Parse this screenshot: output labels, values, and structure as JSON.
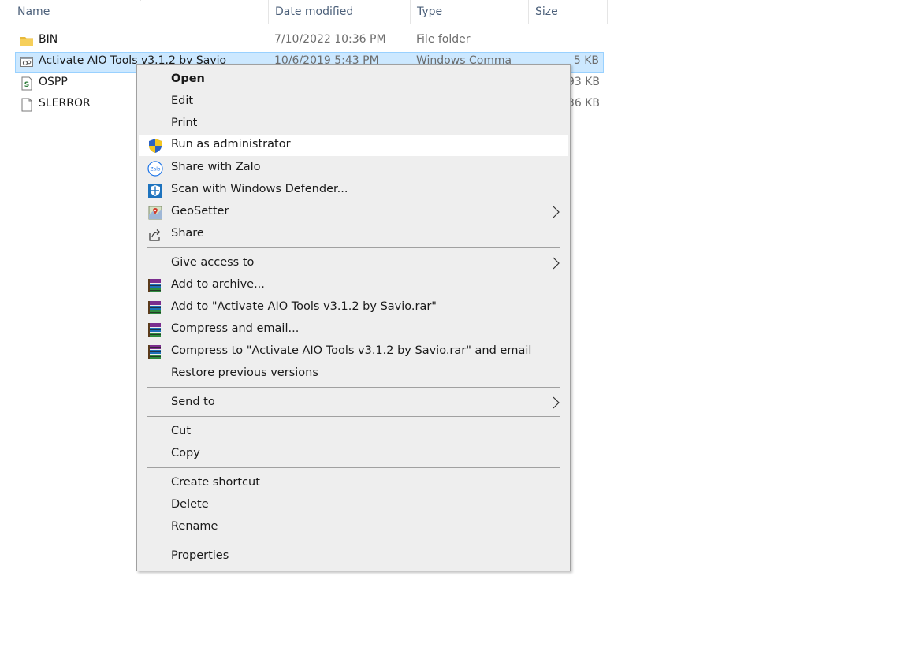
{
  "columns": {
    "name": "Name",
    "date": "Date modified",
    "type": "Type",
    "size": "Size"
  },
  "files": [
    {
      "name": "BIN",
      "date": "7/10/2022 10:36 PM",
      "type": "File folder",
      "size": "",
      "icon": "folder-icon"
    },
    {
      "name": "Activate AIO Tools v3.1.2 by Savio",
      "date": "10/6/2019 5:43 PM",
      "type": "Windows Comma",
      "size": "5 KB",
      "icon": "cmd-file-icon",
      "selected": true
    },
    {
      "name": "OSPP",
      "date": "",
      "type": "",
      "size": "93 KB",
      "icon": "script-file-icon"
    },
    {
      "name": "SLERROR",
      "date": "",
      "type": "",
      "size": "36 KB",
      "icon": "blank-file-icon"
    }
  ],
  "menu": {
    "open": "Open",
    "edit": "Edit",
    "print": "Print",
    "run_admin": "Run as administrator",
    "share_zalo": "Share with Zalo",
    "zalo_icon_text": "Zalo",
    "scan_defender": "Scan with Windows Defender...",
    "geosetter": "GeoSetter",
    "share": "Share",
    "give_access": "Give access to",
    "add_archive": "Add to archive...",
    "add_to_rar": "Add to \"Activate AIO Tools v3.1.2 by Savio.rar\"",
    "compress_email": "Compress and email...",
    "compress_to_rar_email": "Compress to \"Activate AIO Tools v3.1.2 by Savio.rar\" and email",
    "restore": "Restore previous versions",
    "send_to": "Send to",
    "cut": "Cut",
    "copy": "Copy",
    "create_shortcut": "Create shortcut",
    "delete": "Delete",
    "rename": "Rename",
    "properties": "Properties"
  },
  "colors": {
    "selection": "#cce8ff",
    "selection_border": "#99d1ff",
    "menu_bg": "#eeeeee",
    "hover": "#ffffff",
    "header_text": "#4c607a"
  }
}
